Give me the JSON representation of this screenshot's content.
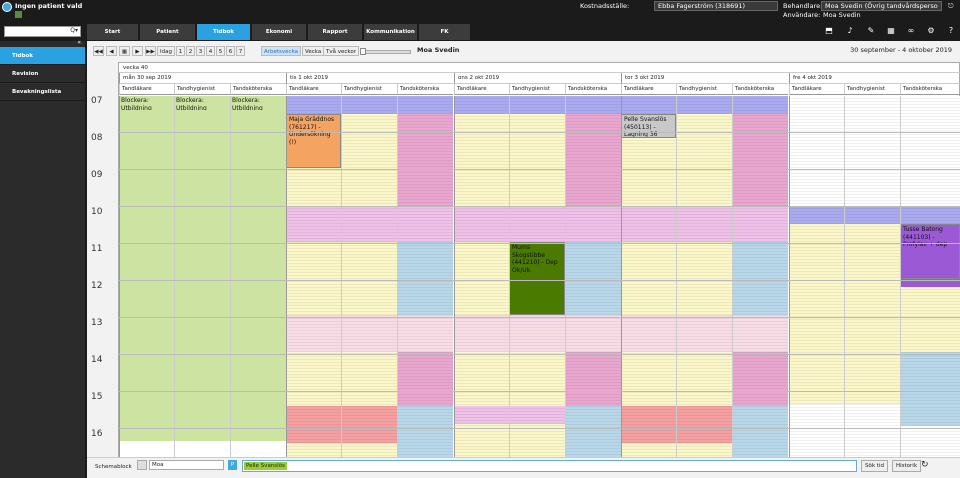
{
  "header": {
    "patient_title": "Ingen patient vald",
    "kost_label": "Kostnadsställe:",
    "kost_value": "Ebba Fagerström (318691)",
    "beh_label": "Behandlare:",
    "beh_value": "Moa Svedin (Övrig tandvårdsperso",
    "user_label": "Användare:",
    "user_value": "Moa Svedin"
  },
  "nav": {
    "tabs": [
      "Start",
      "Patient",
      "Tidbok",
      "Ekonomi",
      "Rapport",
      "Kommunikation",
      "FK"
    ],
    "active": "Tidbok",
    "search_icon": "Q▾"
  },
  "sidebar": {
    "items": [
      "Tidbok",
      "Revision",
      "Bevakningslista"
    ],
    "active": "Tidbok",
    "collapse": "«"
  },
  "toolbar": {
    "nav_buttons": [
      "◀◀",
      "◀",
      "▦",
      "▶",
      "▶▶"
    ],
    "today": "Idag",
    "days": [
      "1",
      "2",
      "3",
      "4",
      "5",
      "6",
      "7"
    ],
    "arbetsvecka": "Arbetsvecka",
    "vecka": "Vecka",
    "tva_veckor": "Två veckor",
    "name": "Moa Svedin",
    "range": "30 september - 4 oktober 2019"
  },
  "calendar": {
    "week_label": "vecka 40",
    "days": [
      "mån 30 sep 2019",
      "tis 1 okt 2019",
      "ons 2 okt 2019",
      "tor 3 okt 2019",
      "fre 4 okt 2019"
    ],
    "columns": [
      "Tandläkare",
      "Tandhygienist",
      "Tandsköterska"
    ],
    "hours": [
      "07",
      "08",
      "09",
      "10",
      "11",
      "12",
      "13",
      "14",
      "15",
      "16"
    ],
    "blocked": [
      "Blockera: Utbildning FRENDA",
      "Blockera: Utbildning FRENDA",
      "Blockera: Utbildning FRENDA"
    ],
    "appointments": [
      {
        "text": "Maja Gräddnos (761217) - Undersökning (!)",
        "color": "#f4a460"
      },
      {
        "text": "Mums Skogstibbe (441210) - Dep Ok/Uk",
        "color": "#4a7a00"
      },
      {
        "text": "Pelle Svanslös (450113) - Lagning 36",
        "color": "#c8c8c8"
      },
      {
        "text": "Tusse Batong (441103) - Profylax + dep",
        "color": "#9b59d6"
      }
    ],
    "colors": {
      "yellow": "#fbf7c9",
      "pink": "#e9a6cf",
      "blue": "#b8d8ea",
      "lavender": "#aaaaf0",
      "lightpink": "#f9dde6",
      "mauve": "#efc0e8",
      "red": "#f5a0a0",
      "green": "#cde3a1"
    }
  },
  "bottom": {
    "label": "Schemablock",
    "select_value": "Moa",
    "chip": "Pelle Svanslös",
    "sok_tid": "Sök tid",
    "historik": "Historik"
  }
}
